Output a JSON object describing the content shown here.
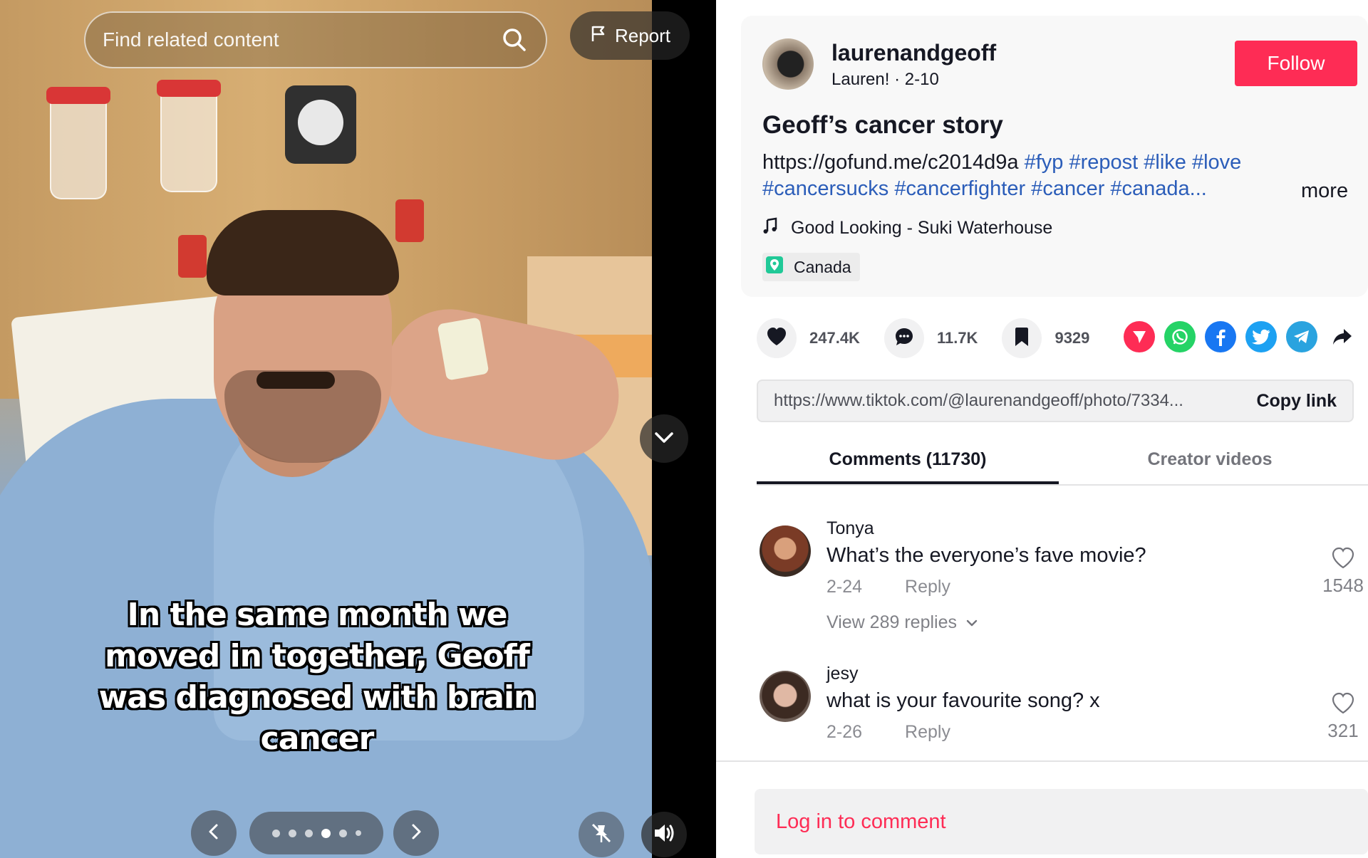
{
  "viewer": {
    "search_placeholder": "Find related content",
    "report_label": "Report",
    "caption": "In the same month we moved in together, Geoff was diagnosed with brain cancer",
    "slides": {
      "count": 6,
      "active": 3
    }
  },
  "post": {
    "username": "laurenandgeoff",
    "display_name": "Lauren!",
    "date": "2-10",
    "follow_label": "Follow",
    "title": "Geoff’s cancer story",
    "description_link": "https://gofund.me/c2014d9a",
    "hashtags_line1": "#fyp #repost #like #love",
    "hashtags_line2": "#cancersucks #cancerfighter #cancer #canada...",
    "more_label": "more",
    "music": "Good Looking - Suki Waterhouse",
    "location": "Canada"
  },
  "stats": {
    "likes": "247.4K",
    "comments": "11.7K",
    "saves": "9329"
  },
  "share_icons": [
    "repost-icon",
    "whatsapp-icon",
    "facebook-icon",
    "twitter-icon",
    "telegram-icon",
    "share-arrow-icon"
  ],
  "colors": {
    "accent": "#fe2c55",
    "hashtag": "#2b5db9",
    "whatsapp": "#25d366",
    "facebook": "#1877f2",
    "twitter": "#1da1f2",
    "telegram": "#2aa3df"
  },
  "link": {
    "url": "https://www.tiktok.com/@laurenandgeoff/photo/7334...",
    "copy_label": "Copy link"
  },
  "tabs": [
    "Comments (11730)",
    "Creator videos"
  ],
  "comments": [
    {
      "user": "Tonya",
      "text": "What’s the everyone’s fave movie?",
      "date": "2-24",
      "reply_label": "Reply",
      "likes": "1548",
      "replies_label": "View 289 replies"
    },
    {
      "user": "jesy",
      "text": "what is your favourite song? x",
      "date": "2-26",
      "reply_label": "Reply",
      "likes": "321"
    }
  ],
  "login_label": "Log in to comment"
}
